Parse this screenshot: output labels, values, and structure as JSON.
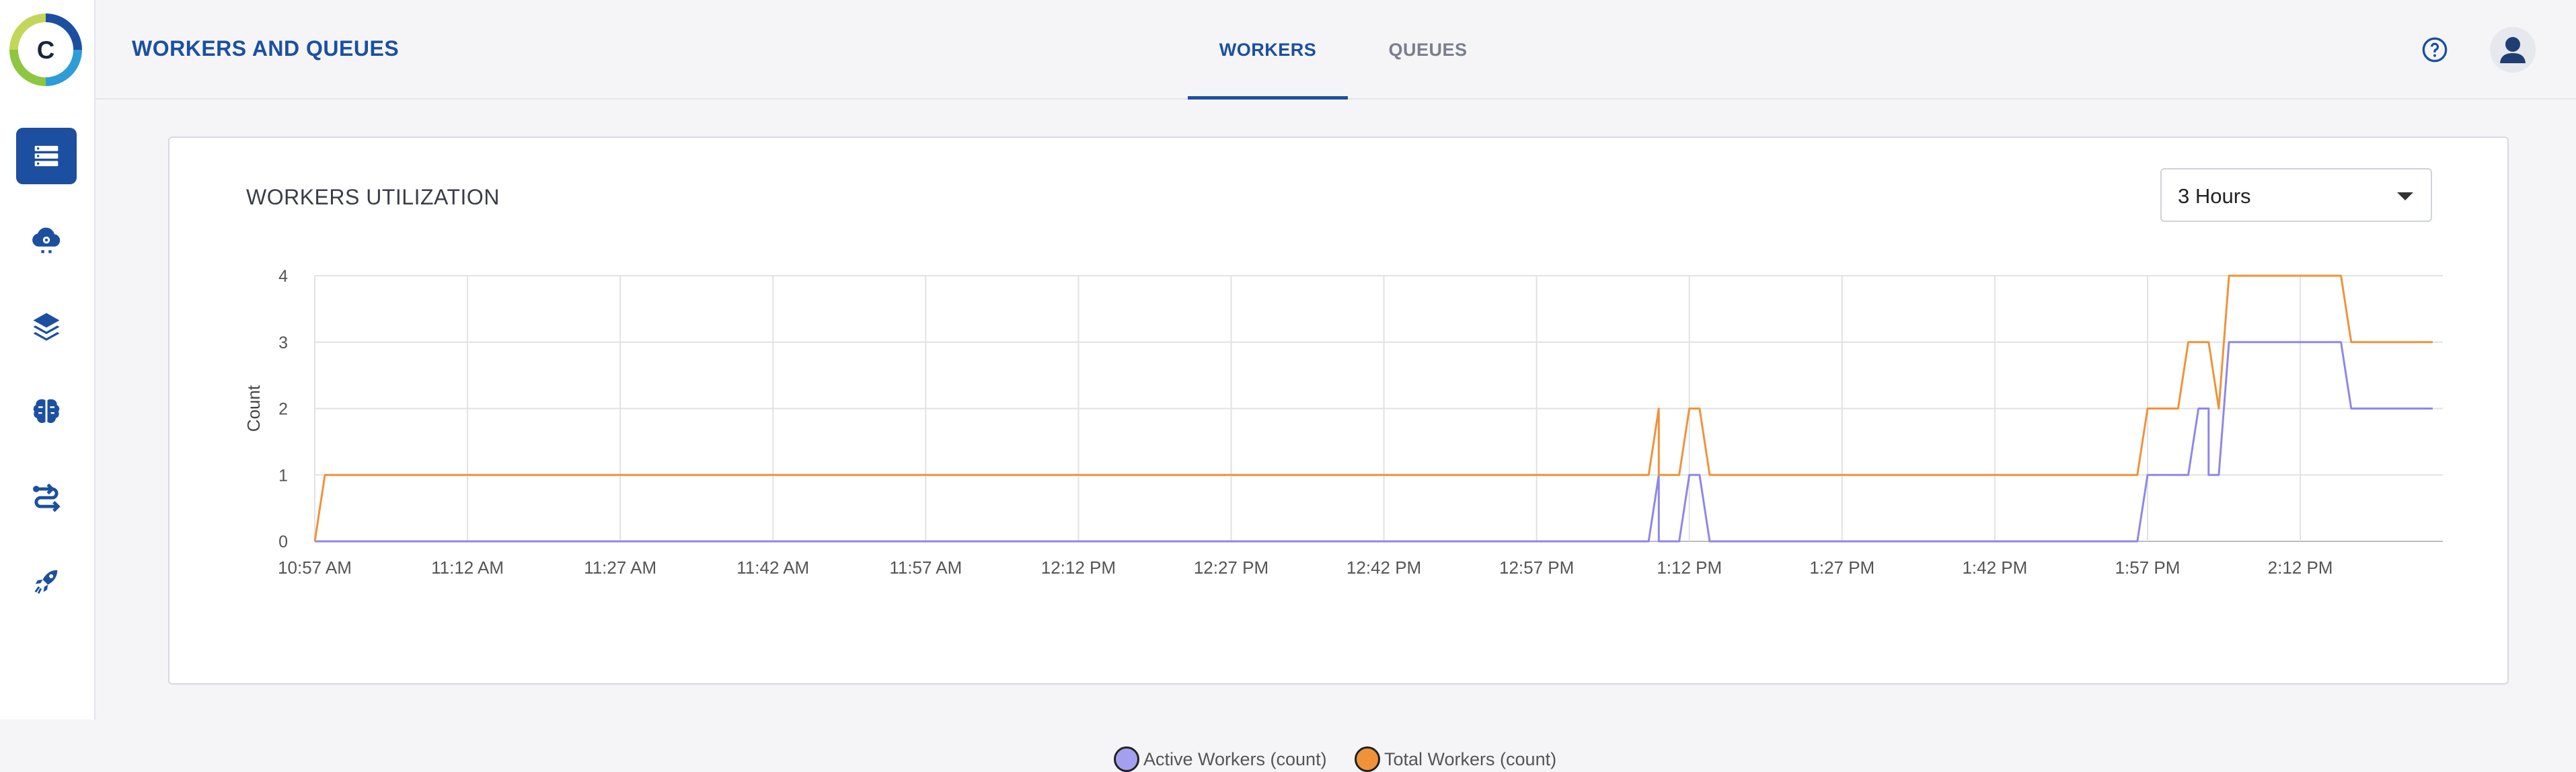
{
  "app": {
    "page_title": "WORKERS AND QUEUES",
    "brand_colors": {
      "primary": "#1c4fa0",
      "active_series": "#8f87e8",
      "total_series": "#f0923a"
    }
  },
  "sidebar": {
    "items": [
      {
        "icon": "workers-queues-icon",
        "active": true
      },
      {
        "icon": "cloud-gear-icon",
        "active": false
      },
      {
        "icon": "layers-icon",
        "active": false
      },
      {
        "icon": "brain-icon",
        "active": false
      },
      {
        "icon": "pipelines-icon",
        "active": false
      },
      {
        "icon": "rocket-icon",
        "active": false
      }
    ]
  },
  "header": {
    "tabs": [
      {
        "label": "WORKERS",
        "active": true
      },
      {
        "label": "QUEUES",
        "active": false
      }
    ],
    "help_icon": "help-icon",
    "profile_icon": "user-avatar-icon"
  },
  "card": {
    "title": "WORKERS UTILIZATION",
    "range_select": {
      "value": "3 Hours"
    }
  },
  "chart_data": {
    "type": "line",
    "ylabel": "Count",
    "xlabel": "",
    "ylim": [
      0,
      4
    ],
    "yticks": [
      0,
      1,
      2,
      3,
      4
    ],
    "xlim": [
      "10:57 AM",
      "2:26 PM"
    ],
    "xticks": [
      "10:57 AM",
      "11:12 AM",
      "11:27 AM",
      "11:42 AM",
      "11:57 AM",
      "12:12 PM",
      "12:27 PM",
      "12:42 PM",
      "12:57 PM",
      "1:12 PM",
      "1:27 PM",
      "1:42 PM",
      "1:57 PM",
      "2:12 PM"
    ],
    "grid": true,
    "legend_position": "bottom",
    "series": [
      {
        "name": "Active Workers (count)",
        "color": "#8f87e8",
        "points": [
          [
            "10:57 AM",
            0
          ],
          [
            "1:08 PM",
            0
          ],
          [
            "1:09 PM",
            1
          ],
          [
            "1:09 PM",
            0
          ],
          [
            "1:11 PM",
            0
          ],
          [
            "1:12 PM",
            1
          ],
          [
            "1:13 PM",
            1
          ],
          [
            "1:14 PM",
            0
          ],
          [
            "1:56 PM",
            0
          ],
          [
            "1:57 PM",
            1
          ],
          [
            "2:01 PM",
            1
          ],
          [
            "2:02 PM",
            2
          ],
          [
            "2:03 PM",
            2
          ],
          [
            "2:03 PM",
            1
          ],
          [
            "2:04 PM",
            1
          ],
          [
            "2:05 PM",
            3
          ],
          [
            "2:16 PM",
            3
          ],
          [
            "2:17 PM",
            2
          ],
          [
            "2:25 PM",
            2
          ]
        ]
      },
      {
        "name": "Total Workers (count)",
        "color": "#f0923a",
        "points": [
          [
            "10:57 AM",
            0
          ],
          [
            "10:58 AM",
            1
          ],
          [
            "1:08 PM",
            1
          ],
          [
            "1:09 PM",
            2
          ],
          [
            "1:09 PM",
            1
          ],
          [
            "1:11 PM",
            1
          ],
          [
            "1:12 PM",
            2
          ],
          [
            "1:13 PM",
            2
          ],
          [
            "1:14 PM",
            1
          ],
          [
            "1:56 PM",
            1
          ],
          [
            "1:57 PM",
            2
          ],
          [
            "2:00 PM",
            2
          ],
          [
            "2:01 PM",
            3
          ],
          [
            "2:03 PM",
            3
          ],
          [
            "2:04 PM",
            2
          ],
          [
            "2:05 PM",
            4
          ],
          [
            "2:16 PM",
            4
          ],
          [
            "2:17 PM",
            3
          ],
          [
            "2:25 PM",
            3
          ]
        ]
      }
    ]
  }
}
